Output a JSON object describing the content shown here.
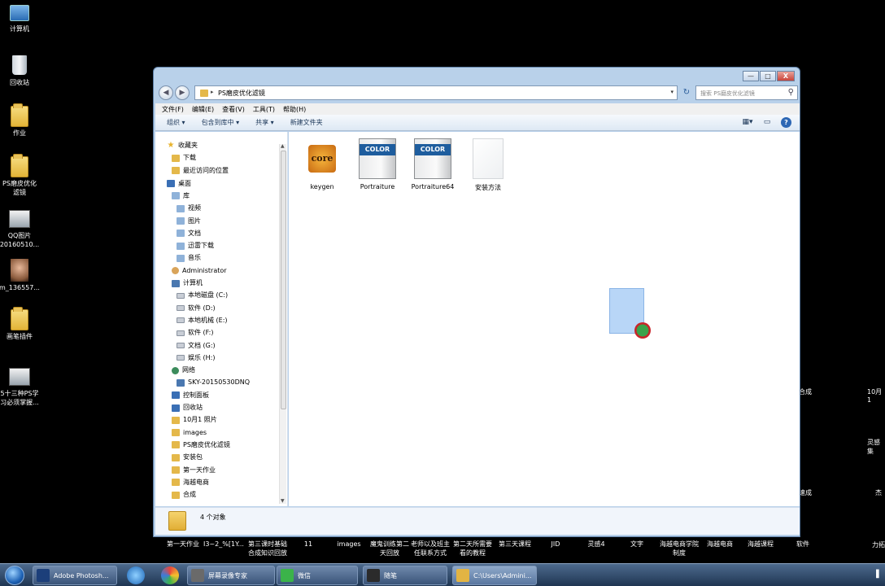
{
  "desktop": {
    "left_icons": [
      {
        "label": "计算机",
        "icon": "computer-icon"
      },
      {
        "label": "回收站",
        "icon": "recycle-bin-icon"
      },
      {
        "label": "作业",
        "icon": "folder-icon"
      },
      {
        "label": "PS磨皮优化\n滤镜",
        "icon": "folder-icon"
      },
      {
        "label": "QQ图片\n20160510...",
        "icon": "image-icon"
      },
      {
        "label": "m_136557...",
        "icon": "portrait-image-icon"
      },
      {
        "label": "画笔插件",
        "icon": "folder-icon"
      },
      {
        "label": "5十三种PS学\n习必须掌握...",
        "icon": "image-icon"
      }
    ],
    "right_edge_labels": [
      "10月1",
      "灵感\n集",
      "杰",
      "力拓",
      "合成",
      "速成"
    ],
    "bottom_labels": [
      "第一天作业",
      "I3~2_%[1Y...",
      "第三课时基础\n合成知识回放",
      "11",
      "images",
      "魔鬼训练第二\n天回放",
      "老师以及班主\n任联系方式",
      "第二天所需要\n看的教程",
      "第三天课程",
      "JID",
      "灵感4",
      "文字",
      "海越电商学院\n制度",
      "海越电商",
      "海越课程",
      "软件"
    ]
  },
  "window": {
    "caption_buttons": {
      "minimize": "—",
      "maximize": "□",
      "close": "X"
    },
    "address": {
      "back": "◀",
      "forward": "▶",
      "separator": "▸",
      "path": "PS磨皮优化滤镜",
      "dropdown": "▾",
      "refresh": "↻"
    },
    "search": {
      "placeholder": "搜索 PS磨皮优化滤镜",
      "icon": "search-icon"
    },
    "menu": [
      "文件(F)",
      "编辑(E)",
      "查看(V)",
      "工具(T)",
      "帮助(H)"
    ],
    "toolbar": {
      "organize": "组织 ▾",
      "include_library": "包含到库中 ▾",
      "share": "共享 ▾",
      "new_folder": "新建文件夹",
      "help": "?"
    },
    "nav": [
      {
        "label": "收藏夹",
        "icon": "star",
        "indent": 0
      },
      {
        "label": "下载",
        "icon": "folder",
        "indent": 1
      },
      {
        "label": "最近访问的位置",
        "icon": "folder",
        "indent": 1
      },
      {
        "label": "桌面",
        "icon": "blue",
        "indent": 0
      },
      {
        "label": "库",
        "icon": "lib",
        "indent": 1
      },
      {
        "label": "视频",
        "icon": "lib",
        "indent": 2
      },
      {
        "label": "图片",
        "icon": "lib",
        "indent": 2
      },
      {
        "label": "文档",
        "icon": "lib",
        "indent": 2
      },
      {
        "label": "迅雷下载",
        "icon": "lib",
        "indent": 2
      },
      {
        "label": "音乐",
        "icon": "lib",
        "indent": 2
      },
      {
        "label": "Administrator",
        "icon": "user",
        "indent": 1
      },
      {
        "label": "计算机",
        "icon": "pc",
        "indent": 1
      },
      {
        "label": "本地磁盘 (C:)",
        "icon": "drive",
        "indent": 2
      },
      {
        "label": "软件 (D:)",
        "icon": "drive",
        "indent": 2
      },
      {
        "label": "本地机械 (E:)",
        "icon": "drive",
        "indent": 2
      },
      {
        "label": "软件 (F:)",
        "icon": "drive",
        "indent": 2
      },
      {
        "label": "文档 (G:)",
        "icon": "drive",
        "indent": 2
      },
      {
        "label": "娱乐 (H:)",
        "icon": "drive",
        "indent": 2
      },
      {
        "label": "网络",
        "icon": "net",
        "indent": 1
      },
      {
        "label": "SKY-20150530DNQ",
        "icon": "pc",
        "indent": 2
      },
      {
        "label": "控制面板",
        "icon": "blue",
        "indent": 1
      },
      {
        "label": "回收站",
        "icon": "blue",
        "indent": 1
      },
      {
        "label": "10月1 照片",
        "icon": "folder",
        "indent": 1
      },
      {
        "label": "images",
        "icon": "folder",
        "indent": 1
      },
      {
        "label": "PS磨皮优化滤镜",
        "icon": "folder",
        "indent": 1
      },
      {
        "label": "安装包",
        "icon": "folder",
        "indent": 1
      },
      {
        "label": "第一天作业",
        "icon": "folder",
        "indent": 1
      },
      {
        "label": "海越电商",
        "icon": "folder",
        "indent": 1
      },
      {
        "label": "合成",
        "icon": "folder",
        "indent": 1
      }
    ],
    "files": [
      {
        "label": "keygen",
        "icon": "core-keygen-icon",
        "badge": "core"
      },
      {
        "label": "Portraiture",
        "icon": "color-plugin-icon",
        "badge": "COLOR"
      },
      {
        "label": "Portraiture64",
        "icon": "color-plugin-icon",
        "badge": "COLOR"
      },
      {
        "label": "安装方法",
        "icon": "text-document-icon",
        "badge": ""
      }
    ],
    "status": {
      "count": "4 个对象"
    }
  },
  "taskbar": {
    "tasks": [
      {
        "label": "Adobe Photosh...",
        "color": "#1c3f7a"
      },
      {
        "label": "屏幕录像专家",
        "color": "#6a6a6a"
      },
      {
        "label": "微信",
        "color": "#3bb34a"
      },
      {
        "label": "随笔",
        "color": "#2b2b2b"
      },
      {
        "label": "C:\\Users\\Admini...",
        "color": "#e2b443"
      }
    ]
  }
}
